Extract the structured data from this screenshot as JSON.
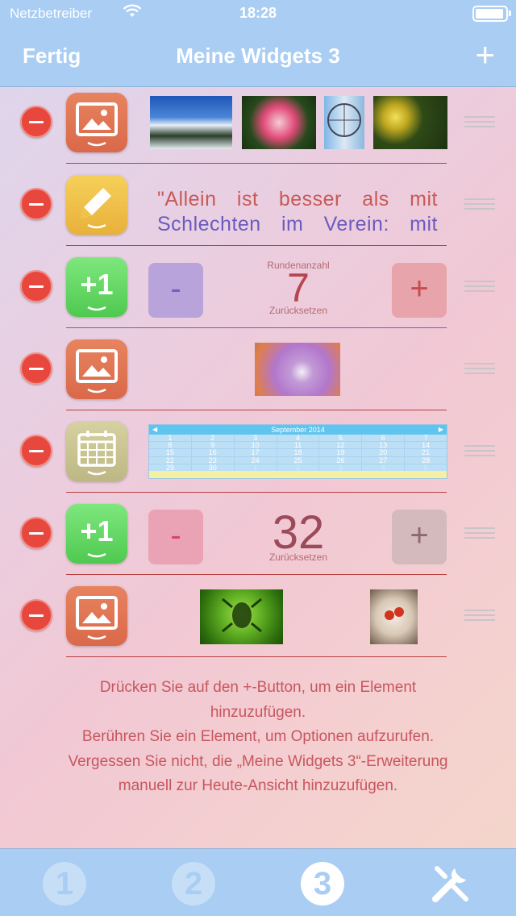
{
  "status": {
    "carrier": "Netzbetreiber",
    "time": "18:28"
  },
  "nav": {
    "left": "Fertig",
    "title": "Meine Widgets 3",
    "add": "+"
  },
  "rows": {
    "note": {
      "line1": "\"Allein ist besser als mit",
      "line2": "Schlechten im Verein: mit"
    },
    "counter1": {
      "minus": "-",
      "plus": "+",
      "label": "Rundenanzahl",
      "value": "7",
      "reset": "Zurücksetzen"
    },
    "calendar": {
      "month": "September 2014",
      "days": [
        "1",
        "2",
        "3",
        "4",
        "5",
        "6",
        "7",
        "8",
        "9",
        "10",
        "11",
        "12",
        "13",
        "14",
        "15",
        "16",
        "17",
        "18",
        "19",
        "20",
        "21",
        "22",
        "23",
        "24",
        "25",
        "26",
        "27",
        "28",
        "29",
        "30",
        "1",
        "2",
        "3",
        "4",
        "5"
      ]
    },
    "counter2": {
      "minus": "-",
      "plus": "+",
      "value": "32",
      "reset": "Zurücksetzen"
    }
  },
  "info": {
    "line1": "Drücken Sie auf den +-Button, um ein Element",
    "line2": "hinzuzufügen.",
    "line3": "Berühren Sie ein Element, um Optionen aufzurufen.",
    "line4": "Vergessen Sie nicht, die „Meine Widgets 3“-Erweiterung",
    "line5": "manuell zur Heute-Ansicht hinzuzufügen."
  },
  "tabs": [
    "1",
    "2",
    "3"
  ],
  "colors": {
    "bar": "#a9cdf3",
    "delete": "#e8473d",
    "accent_red": "#c8565e"
  }
}
